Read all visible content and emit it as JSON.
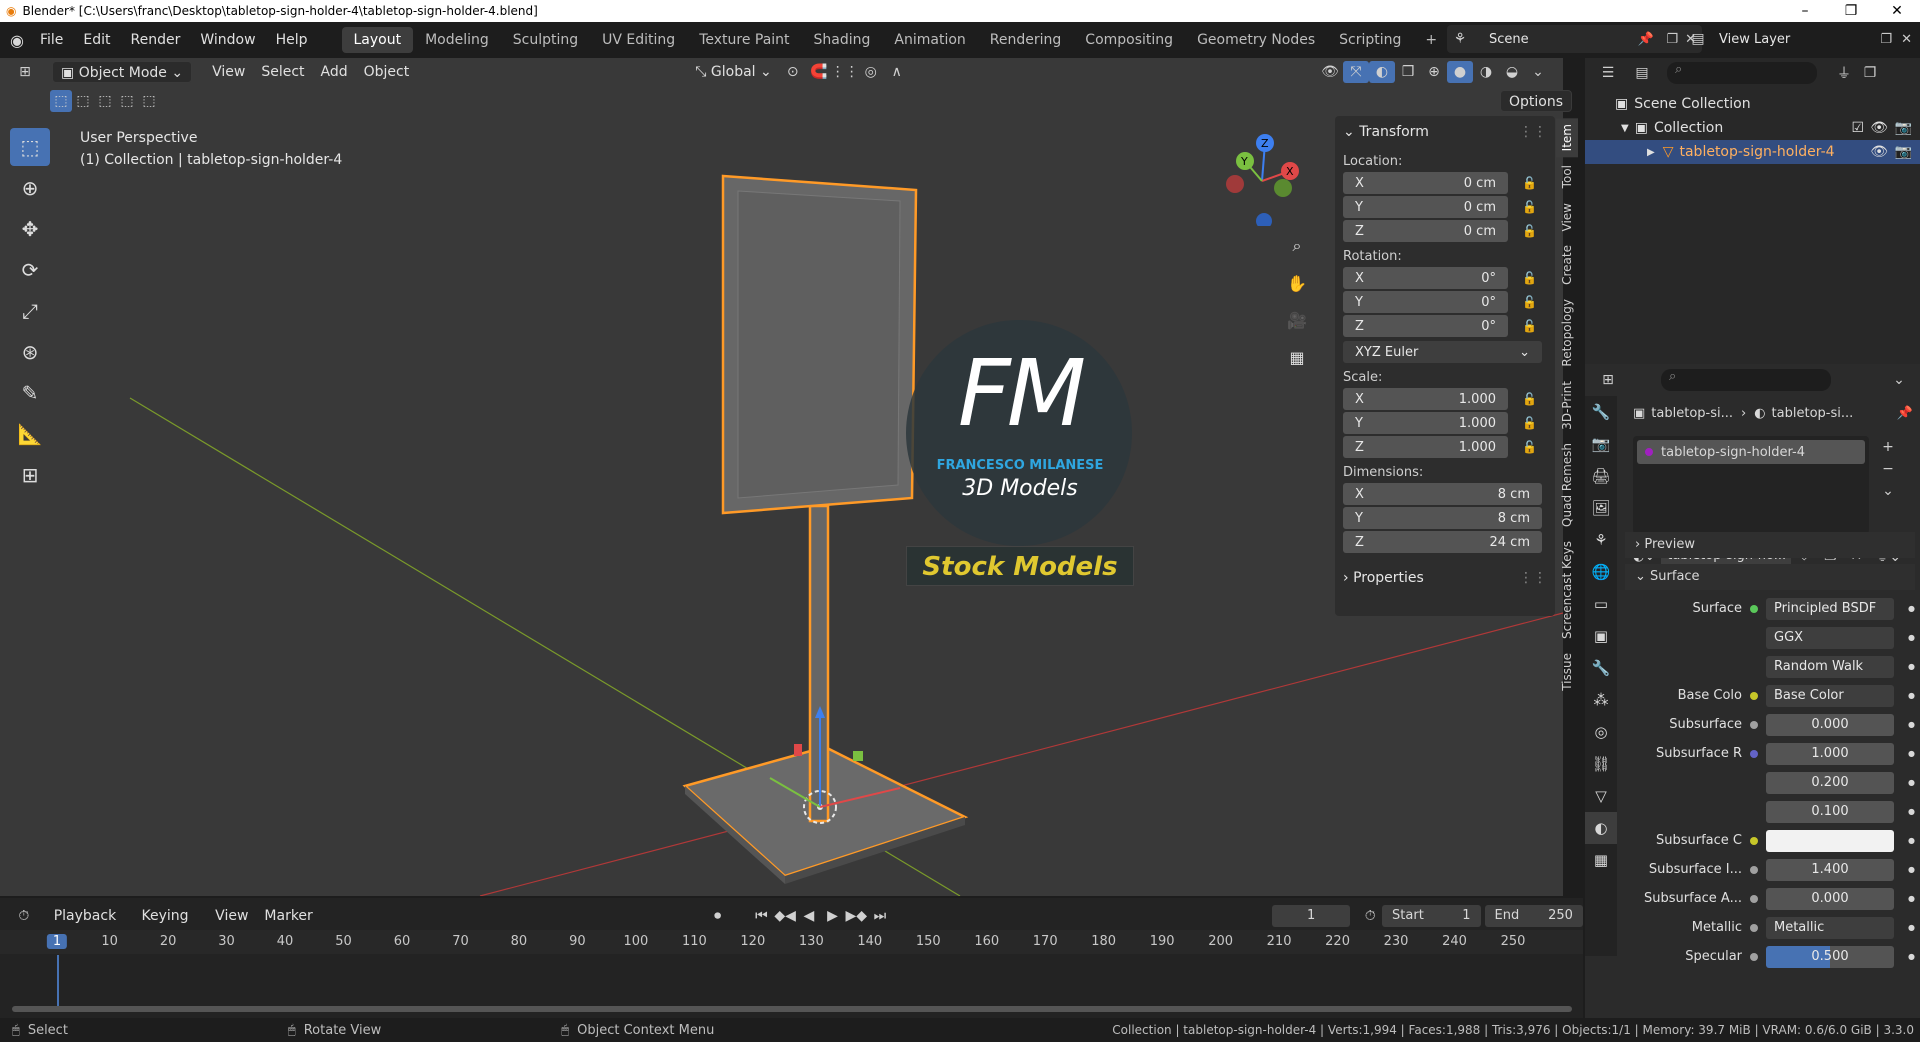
{
  "window_title": "Blender* [C:\\Users\\franc\\Desktop\\tabletop-sign-holder-4\\tabletop-sign-holder-4.blend]",
  "menus": [
    "File",
    "Edit",
    "Render",
    "Window",
    "Help"
  ],
  "workspaces": [
    "Layout",
    "Modeling",
    "Sculpting",
    "UV Editing",
    "Texture Paint",
    "Shading",
    "Animation",
    "Rendering",
    "Compositing",
    "Geometry Nodes",
    "Scripting"
  ],
  "scene": "Scene",
  "view_layer": "View Layer",
  "viewport_header": {
    "mode": "Object Mode",
    "menus": [
      "View",
      "Select",
      "Add",
      "Object"
    ],
    "orientation": "Global",
    "options": "Options"
  },
  "viewport_info": {
    "line1": "User Perspective",
    "line2": "(1) Collection | tabletop-sign-holder-4"
  },
  "watermark": {
    "monogram": "FM",
    "name": "FRANCESCO MILANESE",
    "sub": "3D Models",
    "banner": "Stock Models"
  },
  "gizmo": {
    "z": "Z",
    "y": "Y",
    "x": "X"
  },
  "transform_panel": {
    "title": "Transform",
    "location_label": "Location:",
    "location": [
      {
        "axis": "X",
        "value": "0 cm"
      },
      {
        "axis": "Y",
        "value": "0 cm"
      },
      {
        "axis": "Z",
        "value": "0 cm"
      }
    ],
    "rotation_label": "Rotation:",
    "rotation": [
      {
        "axis": "X",
        "value": "0°"
      },
      {
        "axis": "Y",
        "value": "0°"
      },
      {
        "axis": "Z",
        "value": "0°"
      }
    ],
    "rotation_mode": "XYZ Euler",
    "scale_label": "Scale:",
    "scale": [
      {
        "axis": "X",
        "value": "1.000"
      },
      {
        "axis": "Y",
        "value": "1.000"
      },
      {
        "axis": "Z",
        "value": "1.000"
      }
    ],
    "dimensions_label": "Dimensions:",
    "dimensions": [
      {
        "axis": "X",
        "value": "8 cm"
      },
      {
        "axis": "Y",
        "value": "8 cm"
      },
      {
        "axis": "Z",
        "value": "24 cm"
      }
    ],
    "properties": "Properties"
  },
  "sidebar_tabs": [
    "Item",
    "Tool",
    "View",
    "Create",
    "Retopology",
    "3D-Print",
    "Quad Remesh",
    "Screencast Keys",
    "Tissue"
  ],
  "outliner": {
    "root": "Scene Collection",
    "collection": "Collection",
    "object": "tabletop-sign-holder-4"
  },
  "properties": {
    "breadcrumb_obj": "tabletop-si...",
    "breadcrumb_mat": "tabletop-si...",
    "slot": "tabletop-sign-holder-4",
    "material": "tabletop-sign-ho...",
    "preview": "Preview",
    "surface_section": "Surface",
    "rows": [
      {
        "label": "Surface",
        "value": "Principled BSDF",
        "dot": "#5ac85a",
        "kind": "dark"
      },
      {
        "label": "",
        "value": "GGX",
        "dot": "",
        "kind": "select"
      },
      {
        "label": "",
        "value": "Random Walk",
        "dot": "",
        "kind": "select"
      },
      {
        "label": "Base Colo",
        "value": "Base Color",
        "dot": "#c7c729",
        "kind": "dark"
      },
      {
        "label": "Subsurface",
        "value": "0.000",
        "dot": "#a0a0a0",
        "kind": "num"
      },
      {
        "label": "Subsurface R",
        "value": "1.000",
        "dot": "#6363c7",
        "kind": "num"
      },
      {
        "label": "",
        "value": "0.200",
        "dot": "",
        "kind": "num"
      },
      {
        "label": "",
        "value": "0.100",
        "dot": "",
        "kind": "num"
      },
      {
        "label": "Subsurface C",
        "value": "",
        "dot": "#c7c729",
        "kind": "white"
      },
      {
        "label": "Subsurface I...",
        "value": "1.400",
        "dot": "#a0a0a0",
        "kind": "num"
      },
      {
        "label": "Subsurface A...",
        "value": "0.000",
        "dot": "#a0a0a0",
        "kind": "num"
      },
      {
        "label": "Metallic",
        "value": "Metallic",
        "dot": "#a0a0a0",
        "kind": "dark"
      },
      {
        "label": "Specular",
        "value": "0.500",
        "dot": "#a0a0a0",
        "kind": "blue"
      }
    ]
  },
  "timeline": {
    "menus": [
      "Playback",
      "Keying",
      "View",
      "Marker"
    ],
    "current_frame": "1",
    "start_label": "Start",
    "start": "1",
    "end_label": "End",
    "end": "250",
    "ticks": [
      "1",
      "10",
      "20",
      "30",
      "40",
      "50",
      "60",
      "70",
      "80",
      "90",
      "100",
      "110",
      "120",
      "130",
      "140",
      "150",
      "160",
      "170",
      "180",
      "190",
      "200",
      "210",
      "220",
      "230",
      "240",
      "250"
    ]
  },
  "statusbar": {
    "select": "Select",
    "rotate": "Rotate View",
    "context": "Object Context Menu",
    "stats": "Collection | tabletop-sign-holder-4 | Verts:1,994 | Faces:1,988 | Tris:3,976 | Objects:1/1 | Memory: 39.7 MiB | VRAM: 0.6/6.0 GiB | 3.3.0"
  },
  "colors": {
    "accent": "#4772b3",
    "selection": "#ff9a27",
    "bg": "#393939"
  }
}
